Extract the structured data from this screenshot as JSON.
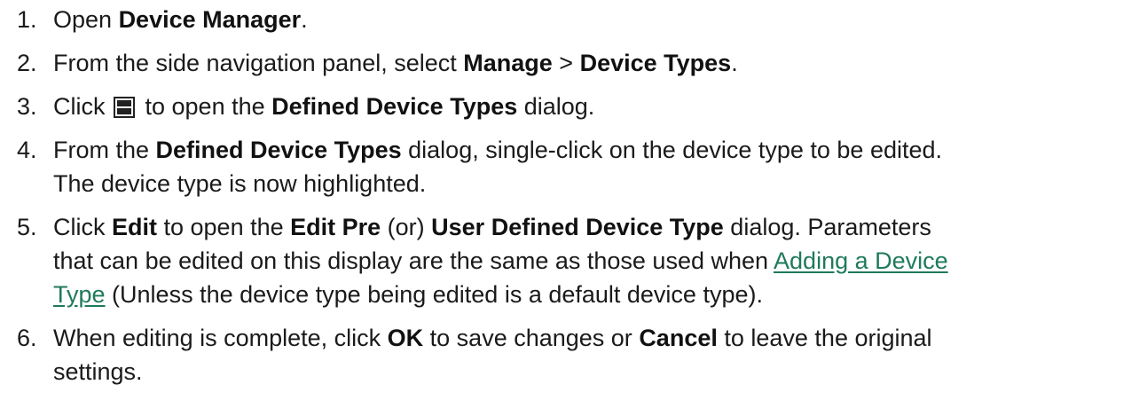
{
  "steps": [
    {
      "num": "1.",
      "p1": "Open ",
      "b1": "Device Manager",
      "p2": "."
    },
    {
      "num": "2.",
      "p1": "From the side navigation panel, select ",
      "b1": "Manage",
      "p2": " > ",
      "b2": "Device Types",
      "p3": "."
    },
    {
      "num": "3.",
      "p1": "Click ",
      "icon": "device-types-icon",
      "p2": " to open the ",
      "b1": "Defined Device Types",
      "p3": " dialog."
    },
    {
      "num": "4.",
      "p1": "From the ",
      "b1": "Defined Device Types",
      "p2": " dialog, single-click on the device type to be edited.",
      "p3": "The device type is now highlighted."
    },
    {
      "num": "5.",
      "p1": "Click ",
      "b1": "Edit",
      "p2": " to open the ",
      "b2": "Edit Pre",
      "p3": " (or) ",
      "b3": "User Defined Device Type",
      "p4": " dialog. Parameters",
      "p5": "that can be edited on this display are the same as those used when ",
      "link1": "Adding a Device",
      "link2": "Type",
      "p6": " (Unless the device type being edited is a default device type)."
    },
    {
      "num": "6.",
      "p1": "When editing is complete, click ",
      "b1": "OK",
      "p2": " to save changes or ",
      "b2": "Cancel",
      "p3": " to leave the original",
      "p4": "settings."
    }
  ]
}
